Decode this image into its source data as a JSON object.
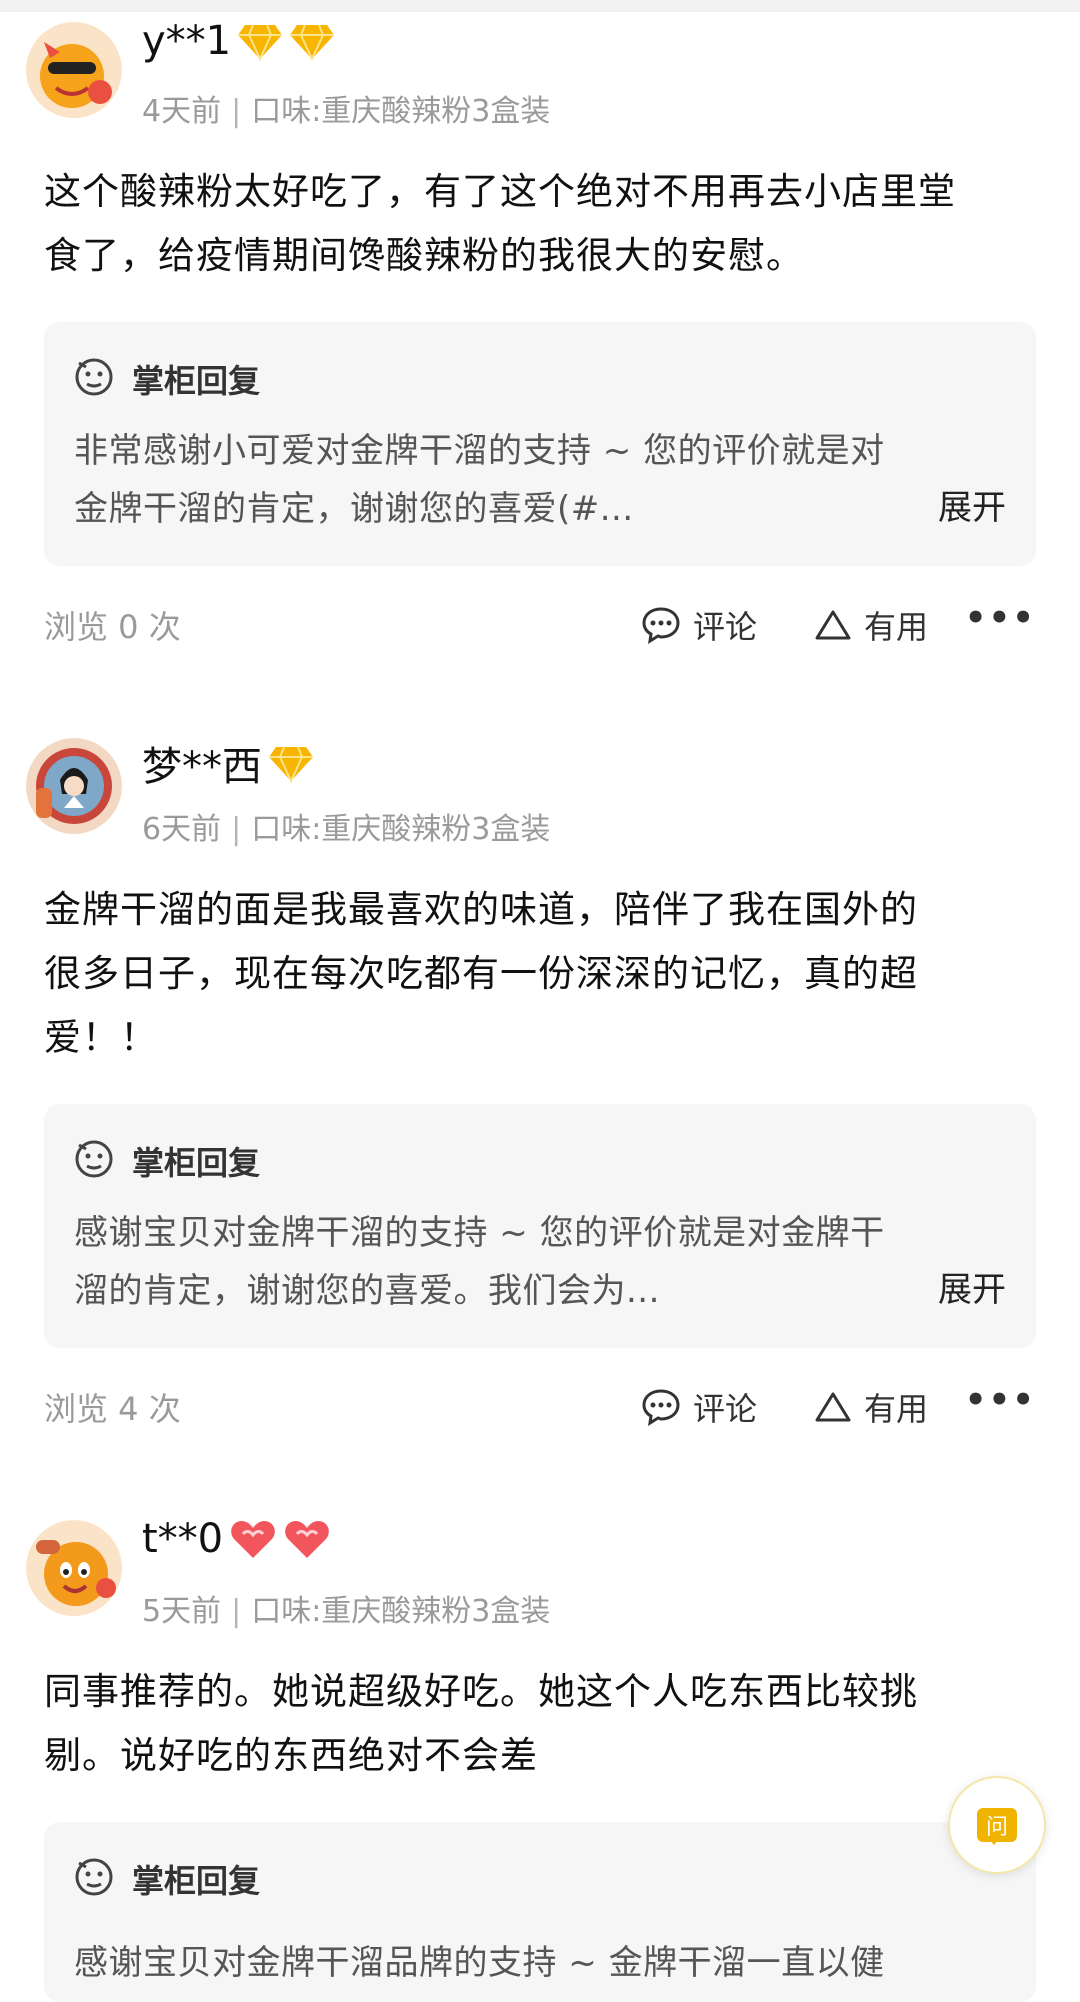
{
  "colors": {
    "accent": "#f0b400",
    "reply_bg": "#f6f6f6",
    "muted": "#9a9a9a"
  },
  "reviews": [
    {
      "user": "y**1",
      "badges": [
        "diamond-badge-icon",
        "diamond-badge-icon"
      ],
      "time": "4天前",
      "flavor": "口味:重庆酸辣粉3盒装",
      "text_lines": [
        "这个酸辣粉太好吃了，有了这个绝对不用再去小店里堂",
        "食了，给疫情期间馋酸辣粉的我很大的安慰。"
      ],
      "reply_title": "掌柜回复",
      "reply_lines": [
        "非常感谢小可爱对金牌干溜的支持 ~ 您的评价就是对",
        "金牌干溜的肯定，谢谢您的喜爱(#..."
      ],
      "expand": "展开",
      "views": "浏览 0 次",
      "comment": "评论",
      "useful": "有用"
    },
    {
      "user": "梦**西",
      "badges": [
        "diamond-badge-icon"
      ],
      "time": "6天前",
      "flavor": "口味:重庆酸辣粉3盒装",
      "text_lines": [
        "金牌干溜的面是我最喜欢的味道，陪伴了我在国外的",
        "很多日子，现在每次吃都有一份深深的记忆，真的超",
        "爱！！"
      ],
      "reply_title": "掌柜回复",
      "reply_lines": [
        "感谢宝贝对金牌干溜的支持 ~ 您的评价就是对金牌干",
        "溜的肯定，谢谢您的喜爱。我们会为..."
      ],
      "expand": "展开",
      "views": "浏览 4 次",
      "comment": "评论",
      "useful": "有用"
    },
    {
      "user": "t**0",
      "badges": [
        "heart-badge-icon",
        "heart-badge-icon"
      ],
      "time": "5天前",
      "flavor": "口味:重庆酸辣粉3盒装",
      "text_lines": [
        "同事推荐的。她说超级好吃。她这个人吃东西比较挑",
        "剔。说好吃的东西绝对不会差"
      ],
      "reply_title": "掌柜回复",
      "reply_lines": [
        "感谢宝贝对金牌干溜品牌的支持 ~ 金牌干溜一直以健"
      ]
    }
  ],
  "ask_button": {
    "label": "问"
  }
}
